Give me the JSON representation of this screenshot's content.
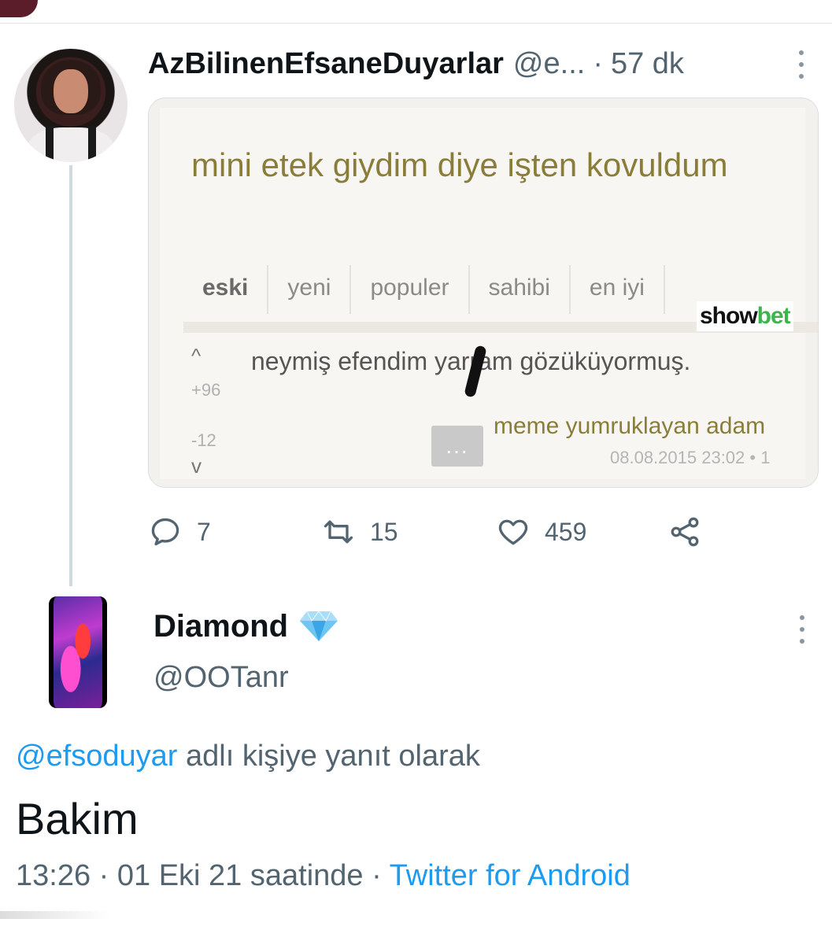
{
  "tweet1": {
    "name": "AzBilinenEfsaneDuyarlar",
    "handle": "@e...",
    "separator": "·",
    "time": "57 dk",
    "media": {
      "title": "mini etek giydim diye işten kovuldum",
      "tabs": [
        "eski",
        "yeni",
        "populer",
        "sahibi",
        "en iyi"
      ],
      "logo_part1": "show",
      "logo_part2": "bet",
      "upvote_icon": "^",
      "upvotes": "+96",
      "comment": "neymiş efendim yarram gözüküyormuş.",
      "downvotes": "-12",
      "downvote_icon": "v",
      "more_button": "...",
      "author": "meme yumruklayan adam",
      "date": "08.08.2015 23:02 • 1"
    },
    "actions": {
      "replies": "7",
      "retweets": "15",
      "likes": "459"
    }
  },
  "tweet2": {
    "name": "Diamond",
    "badge_icon": "diamond-icon",
    "handle": "@OOTanr",
    "reply_mention": "@efsoduyar",
    "reply_suffix": " adlı kişiye yanıt olarak",
    "text": "Bakim",
    "time": "13:26",
    "separator1": " · ",
    "date": "01 Eki 21 saatinde",
    "separator2": " · ",
    "source": "Twitter for Android"
  },
  "colors": {
    "accent": "#1d9bf0",
    "secondary_text": "#536471",
    "primary_text": "#0f1419",
    "logo_green": "#3db54a"
  }
}
